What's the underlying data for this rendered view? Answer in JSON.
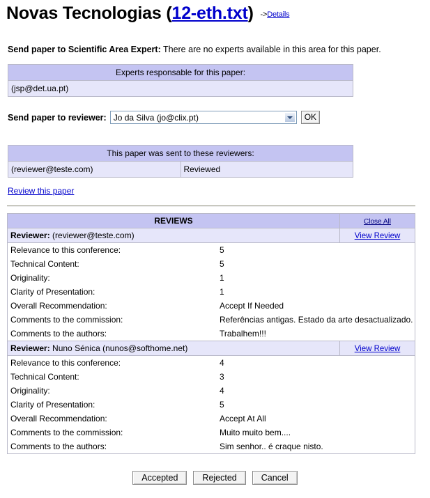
{
  "header": {
    "paper_title": "Novas Tecnologias",
    "open_paren": "(",
    "file_link": "12-eth.txt",
    "close_paren": ")",
    "arrow": "->",
    "details_link": "Details"
  },
  "expert_notice": {
    "label": "Send paper to Scientific Area Expert:",
    "message": "There are no experts available in this area for this paper."
  },
  "experts_table": {
    "header": "Experts responsable for this paper:",
    "rows": [
      "(jsp@det.ua.pt)"
    ]
  },
  "send_reviewer": {
    "label": "Send paper to reviewer:",
    "selected": "Jo da Silva (jo@clix.pt)",
    "ok_label": "OK"
  },
  "sent_table": {
    "header": "This paper was sent to these reviewers:",
    "rows": [
      {
        "reviewer": "(reviewer@teste.com)",
        "status": "Reviewed"
      }
    ]
  },
  "review_paper_link": "Review this paper",
  "reviews": {
    "title": "REVIEWS",
    "close_all": "Close All",
    "view_review": "View Review",
    "reviewer_prefix": "Reviewer:",
    "criteria_labels": [
      "Relevance to this conference:",
      "Technical Content:",
      "Originality:",
      "Clarity of Presentation:",
      "Overall Recommendation:",
      "Comments to the commission:",
      "Comments to the authors:"
    ],
    "items": [
      {
        "reviewer": "(reviewer@teste.com)",
        "values": [
          "5",
          "5",
          "1",
          "1",
          "Accept If Needed",
          "Referências antigas. Estado da arte desactualizado.",
          "Trabalhem!!!"
        ]
      },
      {
        "reviewer": "Nuno Sénica (nunos@softhome.net)",
        "values": [
          "4",
          "3",
          "4",
          "5",
          "Accept At All",
          "Muito muito bem....",
          "Sim senhor.. é craque nisto."
        ]
      }
    ]
  },
  "footer": {
    "accepted": "Accepted",
    "rejected": "Rejected",
    "cancel": "Cancel"
  }
}
